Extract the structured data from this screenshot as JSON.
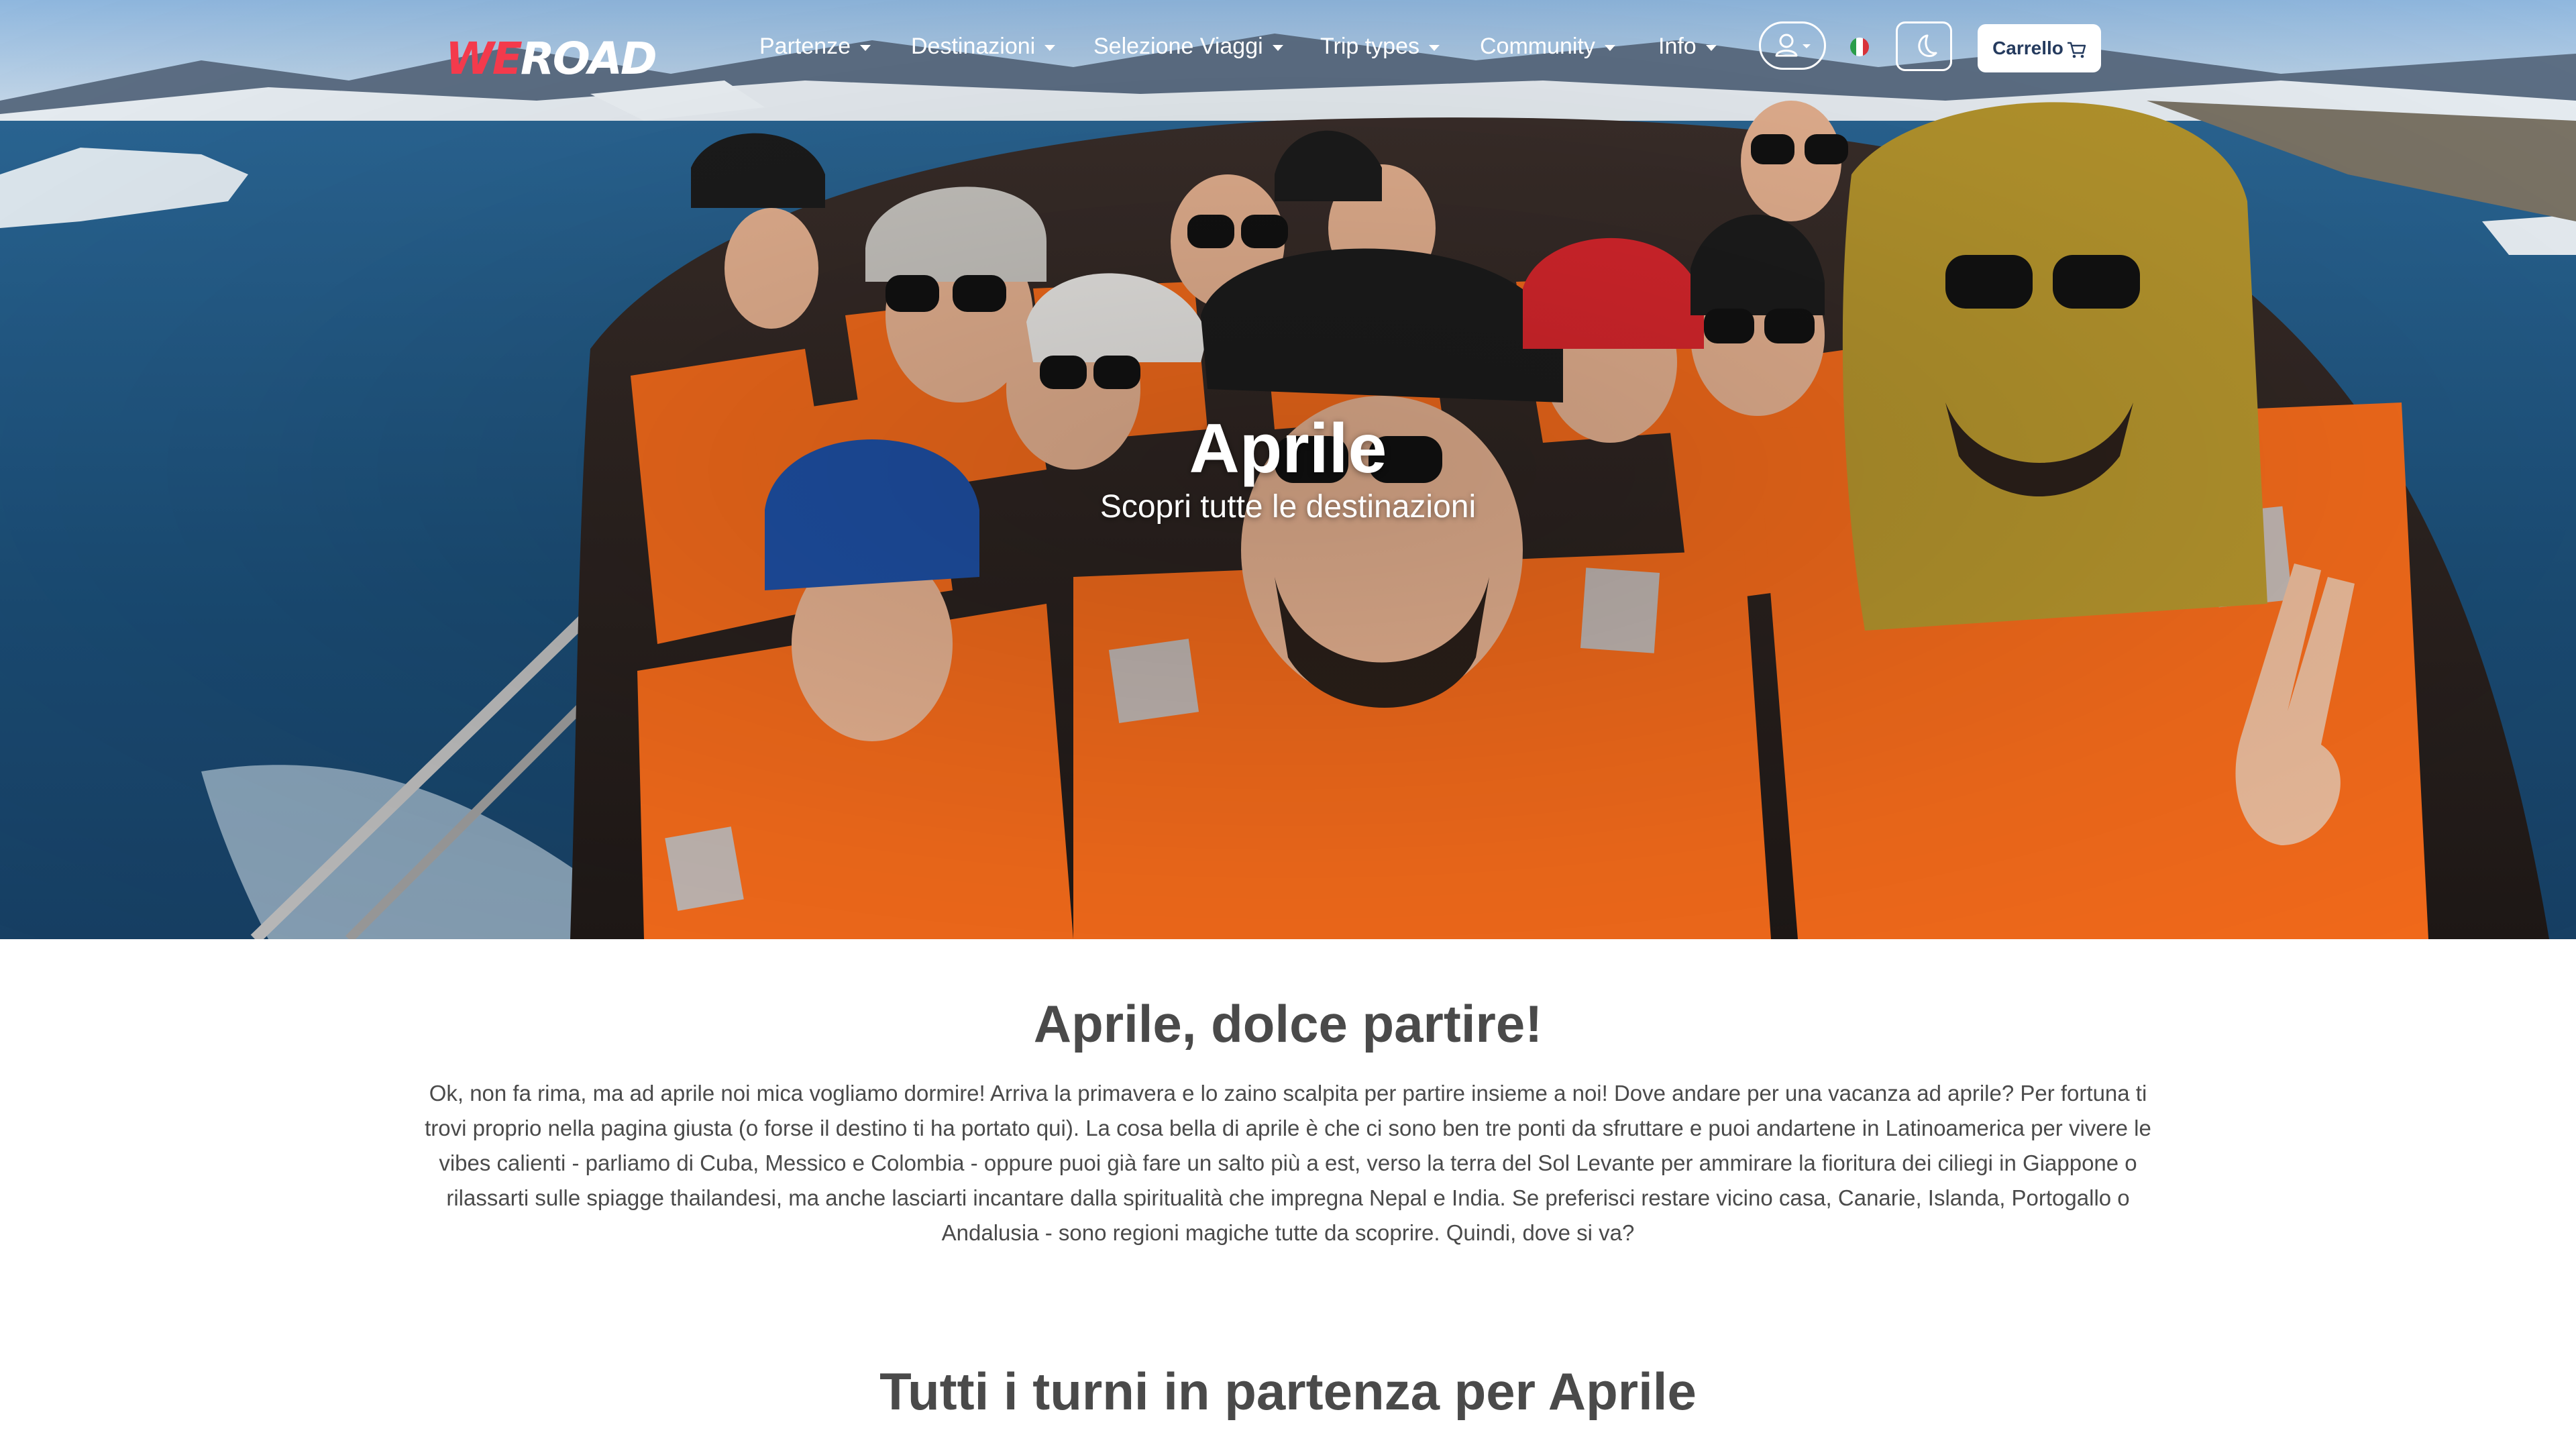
{
  "brand": {
    "logo_we": "WE",
    "logo_road": "ROAD"
  },
  "nav": {
    "items": [
      {
        "label": "Partenze"
      },
      {
        "label": "Destinazioni"
      },
      {
        "label": "Selezione Viaggi"
      },
      {
        "label": "Trip types"
      },
      {
        "label": "Community"
      },
      {
        "label": "Info"
      }
    ],
    "user_icon": "user-icon",
    "language_flag": "italy-flag-icon",
    "theme_icon": "moon-icon",
    "cart_label": "Carrello",
    "cart_icon": "cart-icon"
  },
  "hero": {
    "title": "Aprile",
    "subtitle": "Scopri tutte le destinazioni"
  },
  "intro": {
    "heading": "Aprile, dolce partire!",
    "body": "Ok, non fa rima, ma ad aprile noi mica vogliamo dormire! Arriva la primavera e lo zaino scalpita per partire insieme a noi! Dove andare per una vacanza ad aprile? Per fortuna ti trovi proprio nella pagina giusta (o forse il destino ti ha portato qui). La cosa bella di aprile è che ci sono ben tre ponti da sfruttare e puoi andartene in Latinoamerica per vivere le vibes calienti - parliamo di Cuba, Messico e Colombia - oppure puoi già fare un salto più a est, verso la terra del Sol Levante per ammirare la fioritura dei ciliegi in Giappone o rilassarti sulle spiagge thailandesi, ma anche lasciarti incantare dalla spiritualità che impregna Nepal e India. Se preferisci restare vicino casa, Canarie, Islanda, Portogallo o Andalusia - sono regioni magiche tutte da scoprire. Quindi, dove si va?"
  },
  "departures": {
    "heading": "Tutti i turni in partenza per Aprile"
  },
  "colors": {
    "brand_red": "#f43a4c",
    "cart_text": "#253b5e",
    "heading_text": "#4a4a4a",
    "lifejacket_orange": "#f26a1b",
    "sea_blue": "#1d4f7a"
  }
}
